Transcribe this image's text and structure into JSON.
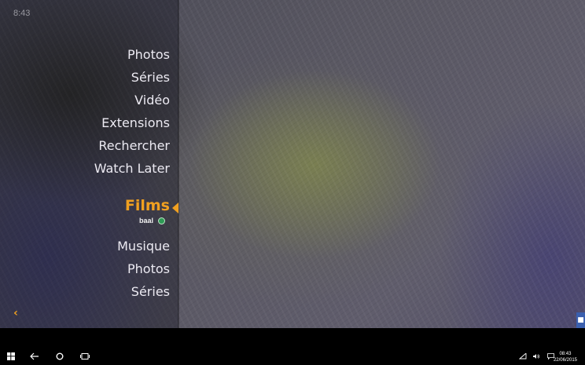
{
  "status": {
    "clock": "8:43"
  },
  "menu": {
    "items": [
      {
        "label": "Photos"
      },
      {
        "label": "Séries"
      },
      {
        "label": "Vidéo"
      },
      {
        "label": "Extensions"
      },
      {
        "label": "Rechercher"
      },
      {
        "label": "Watch Later"
      },
      {
        "label": "Films"
      },
      {
        "label": "Musique"
      },
      {
        "label": "Photos"
      },
      {
        "label": "Séries"
      }
    ],
    "active_index": 6
  },
  "profile": {
    "name": "baal",
    "status_color": "#2e9a55"
  },
  "colors": {
    "accent": "#f0a020",
    "text": "#eceaf2"
  },
  "icons": {
    "back": "chevron-left-icon",
    "corner": "overlay-icon",
    "windows": "windows-start-icon",
    "taskbar_back": "back-arrow-icon",
    "cortana": "circle-icon",
    "task_view": "task-view-icon",
    "wifi": "wifi-icon",
    "volume": "volume-icon",
    "notifications": "notification-icon"
  },
  "taskbar": {
    "time": "08:43",
    "date": "22/06/2015"
  }
}
